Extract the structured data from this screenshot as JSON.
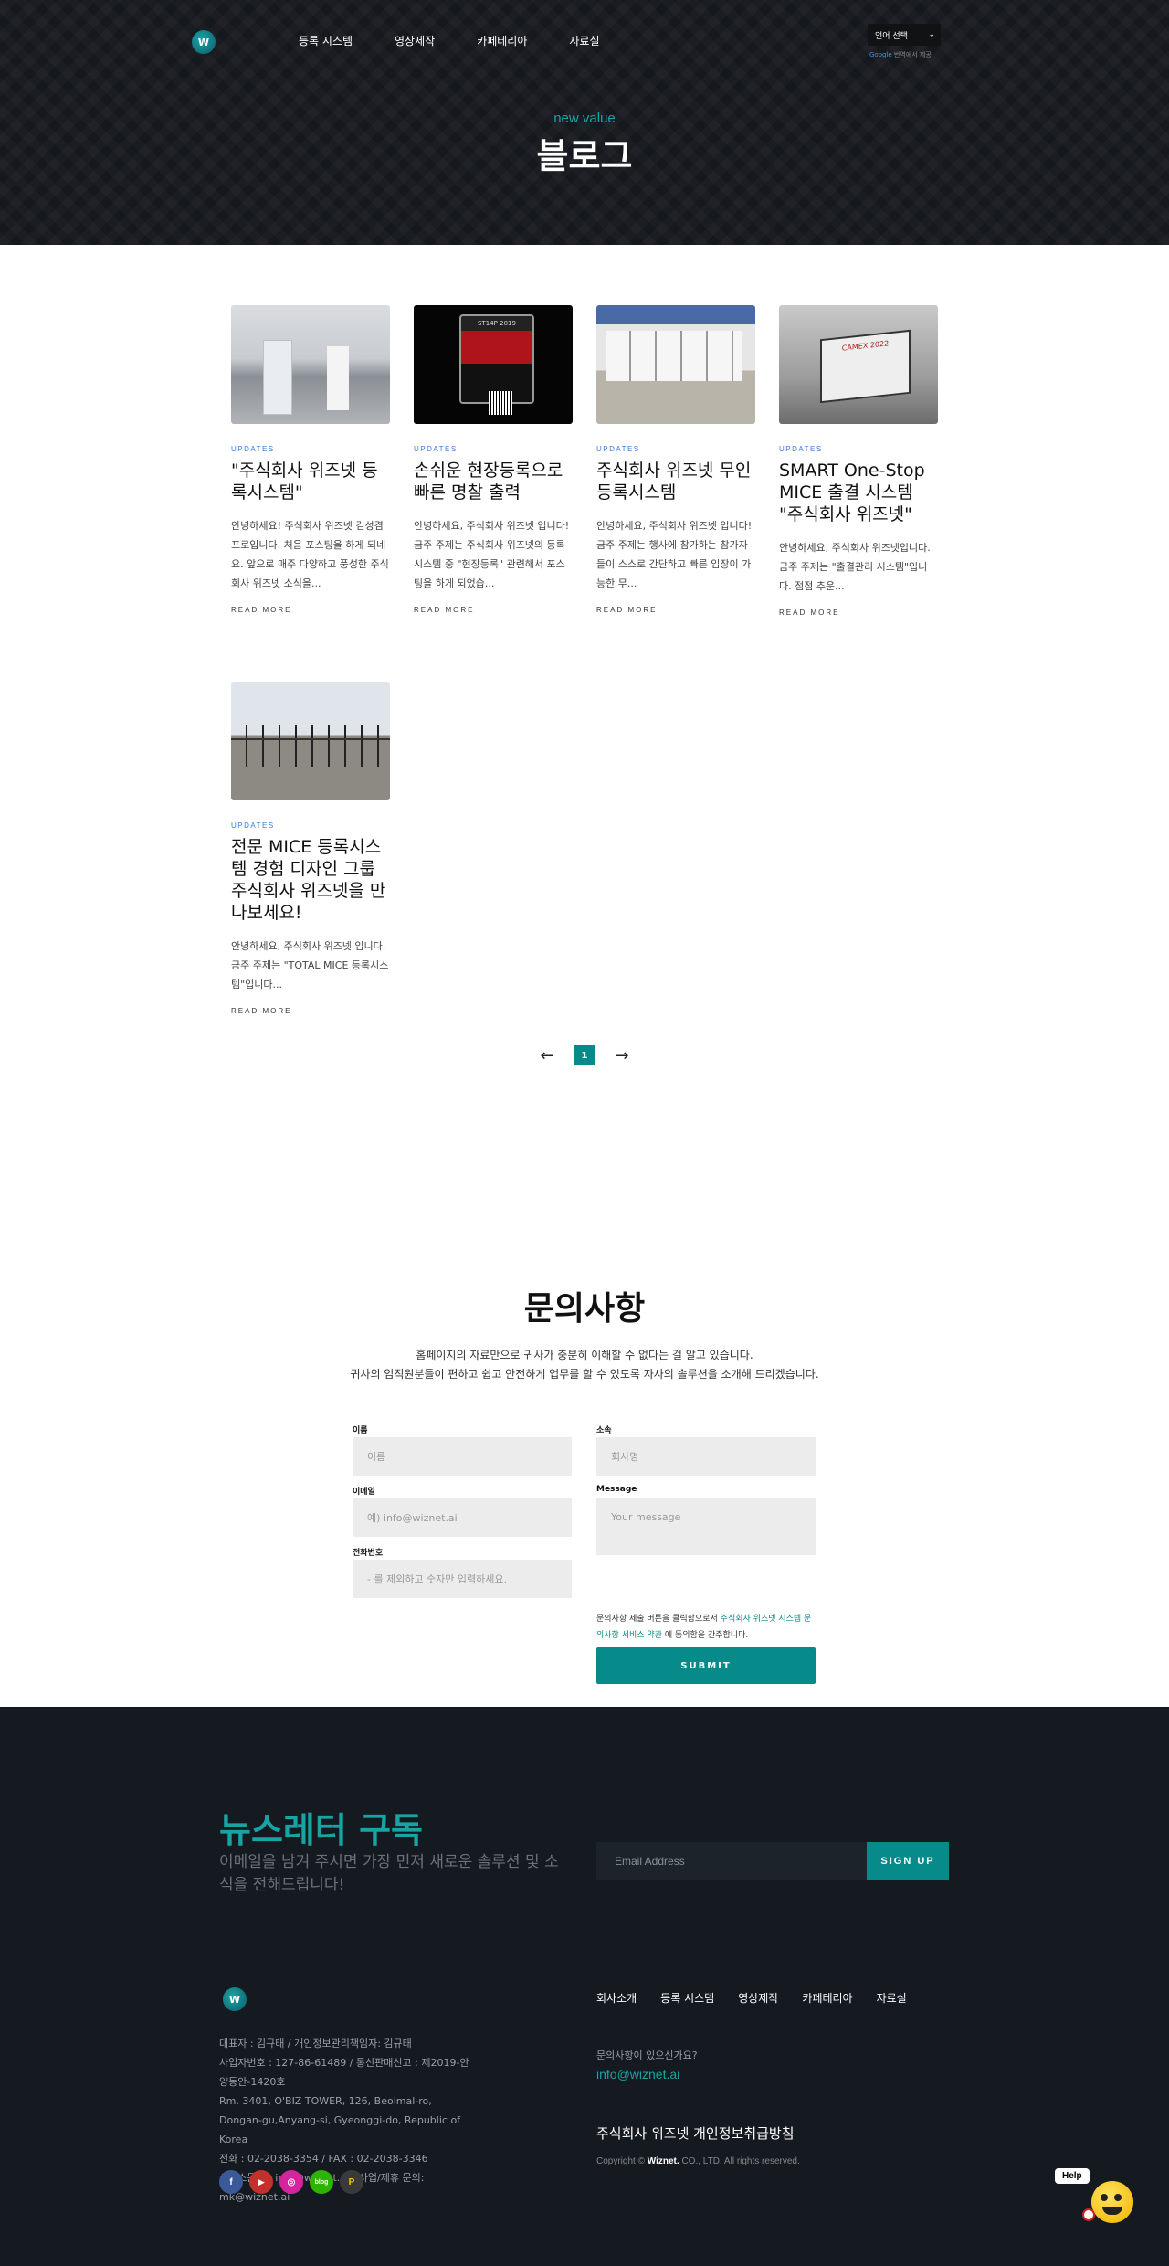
{
  "nav": {
    "logo_text": "W",
    "menu": [
      "등록 시스템",
      "영상제작",
      "카페테리아",
      "자료실"
    ],
    "language_select": "언어 선택",
    "translate_brand": "Google",
    "translate_note": "번역에서 제공"
  },
  "hero": {
    "subtitle": "new value",
    "title": "블로그"
  },
  "blog": {
    "posts": [
      {
        "category": "UPDATES",
        "title": "\"주식회사 위즈넷 등록시스템\"",
        "excerpt": "안녕하세요! 주식회사 위즈넷 김성겸 프로입니다. 처음 포스팅을 하게 되네요. 앞으로 매주 다양하고 풍성한 주식회사 위즈넷 소식을...",
        "read_more": "READ MORE"
      },
      {
        "category": "UPDATES",
        "title": "손쉬운 현장등록으로 빠른 명찰 출력",
        "excerpt": "안녕하세요, 주식회사 위즈넷 입니다!금주 주제는 주식회사 위즈넷의 등록시스템 중 \"현장등록\" 관련해서 포스팅을 하게 되었습...",
        "read_more": "READ MORE"
      },
      {
        "category": "UPDATES",
        "title": "주식회사 위즈넷 무인 등록시스템",
        "excerpt": "안녕하세요, 주식회사 위즈넷 입니다!금주 주제는 행사에 참가하는 참가자들이 스스로 간단하고 빠른 입장이 가능한 무...",
        "read_more": "READ MORE"
      },
      {
        "category": "UPDATES",
        "title": "SMART One-Stop MICE 출결 시스템 \"주식회사 위즈넷\"",
        "excerpt": "안녕하세요, 주식회사 위즈넷입니다. 금주 주제는 \"출결관리 시스템\"입니다. 점점 추운...",
        "read_more": "READ MORE"
      },
      {
        "category": "UPDATES",
        "title": "전문 MICE 등록시스템 경험 디자인 그룹 주식회사 위즈넷을 만나보세요!",
        "excerpt": "안녕하세요, 주식회사 위즈넷 입니다. 금주 주제는 \"TOTAL MICE 등록시스템\"입니다...",
        "read_more": "READ MORE"
      }
    ],
    "pagination": {
      "prev": "←",
      "current": "1",
      "next": "→"
    }
  },
  "inquiry": {
    "title": "문의사항",
    "desc_line1": "홈페이지의 자료만으로 귀사가 충분히 이해할 수 없다는 걸 알고 있습니다.",
    "desc_line2": "귀사의 임직원분들이 편하고 쉽고 안전하게 업무를 할 수 있도록 자사의 솔루션을 소개해 드리겠습니다.",
    "name_label": "이름",
    "name_placeholder": "이름",
    "company_label": "소속",
    "company_placeholder": "회사명",
    "email_label": "이메일",
    "email_placeholder": "예) info@wiznet.ai",
    "message_label": "Message",
    "message_placeholder": "Your message",
    "phone_label": "전화번호",
    "phone_placeholder": "- 를 제외하고 숫자만 입력하세요.",
    "consent_prefix": "문의사항 제출 버튼을 클릭함으로서",
    "consent_link": "주식회사 위즈넷 시스템 문의사항 서비스 약관",
    "consent_suffix": "에 동의함을 간주합니다.",
    "submit_label": "SUBMIT"
  },
  "footer": {
    "newsletter_title": "뉴스레터 구독",
    "newsletter_desc": "이메일을 남겨 주시면 가장 먼저 새로운 솔루션 및 소식을 전해드립니다!",
    "email_placeholder": "Email Address",
    "signup_label": "SIGN UP",
    "logo_text": "W",
    "info_lines": [
      "대표자 : 김규태 / 개인정보관리책임자: 김규태",
      "사업자번호 : 127-86-61489 / 통신판매신고 : 제2019-안양동안-1420호",
      "Rm. 3401, O'BIZ TOWER, 126, Beolmal-ro, Dongan-gu,Anyang-si, Gyeonggi-do, Republic of Korea",
      "전화 : 02-2038-3354 / FAX : 02-2038-3346",
      "서비스문의 : info@wiznet.ai / 사업/제휴 문의: mk@wiznet.ai"
    ],
    "socials": [
      {
        "name": "facebook-icon",
        "glyph": "f",
        "color": "#3b5998"
      },
      {
        "name": "youtube-icon",
        "glyph": "▶",
        "color": "#c4302b"
      },
      {
        "name": "instagram-icon",
        "glyph": "◎",
        "color": "#d6249f"
      },
      {
        "name": "blog-icon",
        "glyph": "blog",
        "color": "#2db400"
      },
      {
        "name": "post-icon",
        "glyph": "P",
        "color": "#3a3a3a"
      }
    ],
    "menu": [
      "회사소개",
      "등록 시스템",
      "영상제작",
      "카페테리아",
      "자료실"
    ],
    "question": "문의사항이 있으신가요?",
    "email": "info@wiznet.ai",
    "privacy": "주식회사 위즈넷 개인정보취급방침",
    "copyright_prefix": "Copyright ©",
    "copyright_brand": "Wiznet.",
    "copyright_suffix": "CO., LTD. All rights reserved.",
    "help_label": "Help"
  },
  "colors": {
    "accent": "#078a8a",
    "hero_bg": "#15181d",
    "footer_bg": "#141a20"
  }
}
